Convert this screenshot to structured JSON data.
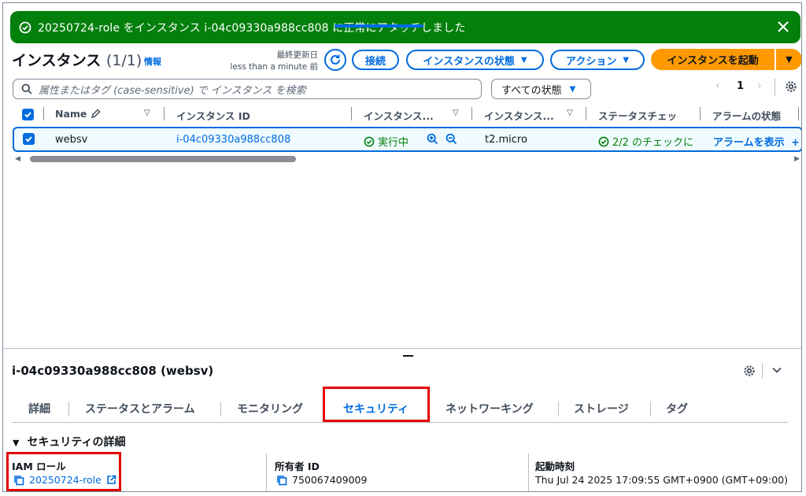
{
  "flash": {
    "message": "20250724-role をインスタンス i-04c09330a988cc808 に正常にアタッチしました",
    "type": "success",
    "color": "#037f0c"
  },
  "header": {
    "title": "インスタンス",
    "count": "(1/1)",
    "info_link": "情報",
    "last_updated_label": "最終更新日",
    "last_updated_value": "less than a minute 前",
    "buttons": {
      "connect": "接続",
      "instance_state": "インスタンスの状態",
      "actions": "アクション",
      "launch": "インスタンスを起動"
    },
    "accent_color": "#006ce0",
    "launch_color": "#ff9900"
  },
  "filter": {
    "search_placeholder": "属性またはタグ (case-sensitive) で インスタンス を検索",
    "state_select": "すべての状態",
    "page": "1"
  },
  "table": {
    "columns": [
      "Name",
      "インスタンス ID",
      "インスタンス...",
      "インスタンス...",
      "ステータスチェッ",
      "アラームの状態"
    ],
    "rows": [
      {
        "name": "websv",
        "instance_id": "i-04c09330a988cc808",
        "state": "実行中",
        "type": "t2.micro",
        "status_check": "2/2 のチェックに",
        "alarm": "アラームを表示"
      }
    ]
  },
  "detail": {
    "title": "i-04c09330a988cc808 (websv)",
    "tabs": [
      "詳細",
      "ステータスとアラーム",
      "モニタリング",
      "セキュリティ",
      "ネットワーキング",
      "ストレージ",
      "タグ"
    ],
    "active_tab": "セキュリティ",
    "section_title": "セキュリティの詳細",
    "fields": {
      "iam_role_label": "IAM ロール",
      "iam_role_value": "20250724-role",
      "owner_label": "所有者 ID",
      "owner_value": "750067409009",
      "launch_time_label": "起動時刻",
      "launch_time_value": "Thu Jul 24 2025 17:09:55 GMT+0900 (GMT+09:00)"
    },
    "highlight_color": "#e30000"
  }
}
